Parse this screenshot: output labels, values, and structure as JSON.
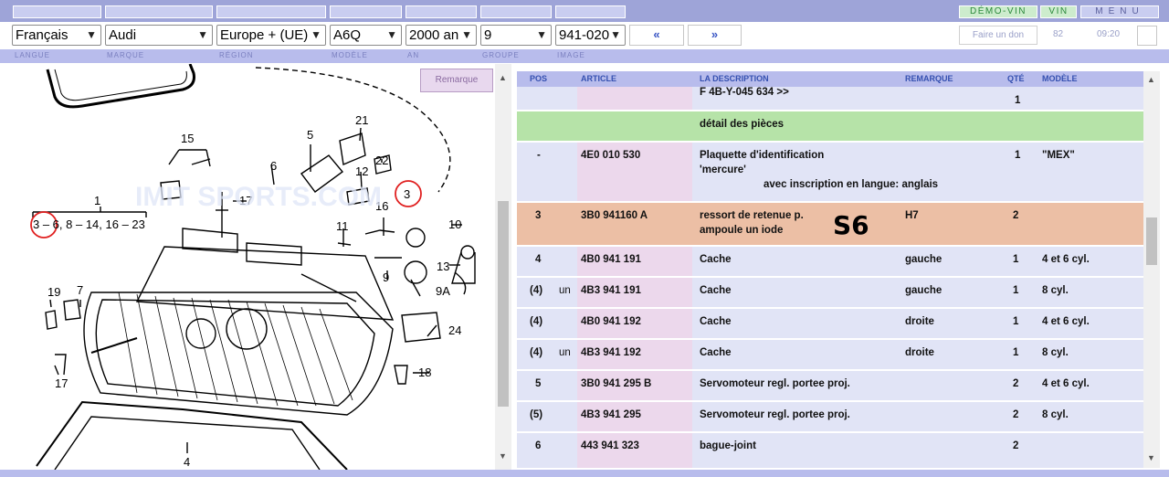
{
  "topbar": {
    "demo_vin": "DÉMO-VIN",
    "vin": "VIN",
    "menu": "MENU"
  },
  "selectors": {
    "language": "Français",
    "brand": "Audi",
    "region": "Europe + (UE)",
    "model": "A6Q",
    "year": "2000 an",
    "group": "9",
    "image": "941-020",
    "prev": "«",
    "next": "»",
    "faire_un_don": "Faire un don",
    "count": "82",
    "time": "09:20"
  },
  "labels": {
    "langue": "LANGUE",
    "marque": "MARQUE",
    "region": "RÉGION",
    "modele": "MODÈLE",
    "an": "AN",
    "groupe": "GROUPE",
    "image": "IMAGE"
  },
  "diagram": {
    "remark_button": "Remarque",
    "callouts": [
      "21",
      "5",
      "15",
      "6",
      "12",
      "22",
      "3",
      "1",
      "17",
      "16",
      "10",
      "11",
      "9",
      "13",
      "9A",
      "19",
      "7",
      "24",
      "18",
      "17",
      "4"
    ],
    "range_label": "3 – 6, 8 – 14, 16 – 23",
    "watermark": "IMIT SPORTS.COM"
  },
  "table": {
    "headers": {
      "pos": "POS",
      "article": "ARTICLE",
      "description": "LA DESCRIPTION",
      "remark": "REMARQUE",
      "qty": "QTÉ",
      "model": "MODÈLE"
    },
    "rows": [
      {
        "kind": "normal",
        "pos": "",
        "article": "",
        "desc": "F 4B-Y-045 634 >>",
        "remark": "",
        "qty": "1",
        "model": ""
      },
      {
        "kind": "green",
        "pos": "",
        "article": "",
        "desc": "détail des pièces",
        "remark": "",
        "qty": "",
        "model": ""
      },
      {
        "kind": "normal",
        "pos": "-",
        "article": "4E0 010 530",
        "desc": "Plaquette d'identification",
        "desc2": "'mercure'",
        "desc3": "avec inscription en langue:  anglais",
        "remark": "",
        "qty": "1",
        "model": "\"MEX\""
      },
      {
        "kind": "orange",
        "pos": "3",
        "article": "3B0 941160 A",
        "desc": "ressort de retenue p.",
        "desc2": "ampoule un iode",
        "remark": "H7",
        "qty": "2",
        "model": "",
        "overlay": "S6"
      },
      {
        "kind": "normal",
        "pos": "4",
        "article": "4B0 941 191",
        "desc": "Cache",
        "remark": "gauche",
        "qty": "1",
        "model": "4 et 6 cyl."
      },
      {
        "kind": "normal",
        "pos": "(4)",
        "prefix": "un",
        "article": "4B3 941 191",
        "desc": "Cache",
        "remark": "gauche",
        "qty": "1",
        "model": "8 cyl."
      },
      {
        "kind": "normal",
        "pos": "(4)",
        "article": "4B0 941 192",
        "desc": "Cache",
        "remark": "droite",
        "qty": "1",
        "model": "4 et 6 cyl."
      },
      {
        "kind": "normal",
        "pos": "(4)",
        "prefix": "un",
        "article": "4B3 941 192",
        "desc": "Cache",
        "remark": "droite",
        "qty": "1",
        "model": "8 cyl."
      },
      {
        "kind": "normal",
        "pos": "5",
        "article": "3B0 941 295 B",
        "desc": "Servomoteur regl. portee proj.",
        "remark": "",
        "qty": "2",
        "model": "4 et 6 cyl."
      },
      {
        "kind": "normal",
        "pos": "(5)",
        "article": "4B3 941 295",
        "desc": "Servomoteur regl. portee proj.",
        "remark": "",
        "qty": "2",
        "model": "8 cyl."
      },
      {
        "kind": "normal",
        "pos": "6",
        "article": "443 941 323",
        "desc": "bague-joint",
        "remark": "",
        "qty": "2",
        "model": ""
      }
    ]
  },
  "colors": {
    "accent": "#9ea4d8",
    "header_label": "#3550b0",
    "highlight_row": "#ecbfa5",
    "section_row": "#b6e3a8",
    "article_col": "#ecd8ec"
  }
}
